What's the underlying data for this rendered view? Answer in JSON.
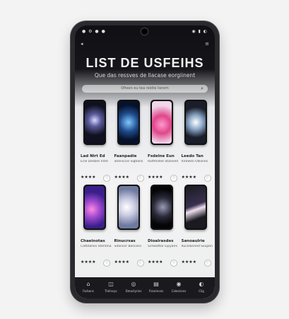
{
  "status_bar": {
    "left": "● ⚙ ● ●",
    "right": "◉ ▮ ◐"
  },
  "top_bar": {
    "left_icon": "◂",
    "right_icon": "≡"
  },
  "page": {
    "title": "LIST DE USFEIHS",
    "subtitle": "Que das ressves de llacase eorgiinent"
  },
  "search": {
    "placeholder": "Ofieen eu tea reidte lierem"
  },
  "products": [
    {
      "name": "Lad Nirt Ed",
      "desc": "Ecle Desbes Intel",
      "rating": "★★★★",
      "screen": "radial-gradient(circle at 50% 45%, #d9d9ff 0%, #5a5a9a 25%, #101020 60%)"
    },
    {
      "name": "Faanpadie",
      "desc": "Sheniccie Sigtions",
      "rating": "★★★★",
      "screen": "radial-gradient(circle at 50% 50%, #7fc8ff 0%, #1e4a8a 40%, #06112a 75%)"
    },
    {
      "name": "Fsdelne Eun",
      "desc": "Ruthhidee Stanned",
      "rating": "★★★★",
      "screen": "radial-gradient(circle at 50% 55%, #ff9ad0 0%, #e0468a 35%, #f0d6ea 75%)"
    },
    {
      "name": "Leedo Tan",
      "desc": "Rirewen Olliones",
      "rating": "★★★★",
      "screen": "radial-gradient(circle at 50% 50%, #ffffff 0%, #8ca8c8 30%, #1a1e2a 65%)"
    },
    {
      "name": "Chaeinotas",
      "desc": "Cattitanes Stentina",
      "rating": "★★★★",
      "screen": "radial-gradient(circle at 35% 55%, #ff8ae0 0%, #a04ad0 30%, #3a1f8a 65%)"
    },
    {
      "name": "Rinucrsas",
      "desc": "Sdancer Bancess",
      "rating": "★★★★",
      "screen": "radial-gradient(circle at 40% 50%, #ffffff 0%, #c9c9e0 35%, #6f7aa0 75%)"
    },
    {
      "name": "Dioalrasdes",
      "desc": "Schwattar Eipyalrs",
      "rating": "★★★★",
      "screen": "radial-gradient(circle at 55% 50%, #9a9ab5 0%, #2a2a3a 40%, #050507 75%)"
    },
    {
      "name": "Sanoaulrie",
      "desc": "Rucolanned Ssupen",
      "rating": "★★★★",
      "screen": "linear-gradient(160deg, #1a1a20 0%, #3a3050 45%, #f0e0f0 55%, #1a1a20 75%)"
    }
  ],
  "bottom_nav": [
    {
      "icon": "⌂",
      "label": "Farbons"
    },
    {
      "icon": "◫",
      "label": "Trelinsys"
    },
    {
      "icon": "◎",
      "label": "Dmactyries"
    },
    {
      "icon": "▤",
      "label": "Frzarmces"
    },
    {
      "icon": "◉",
      "label": "Calesrions"
    },
    {
      "icon": "◐",
      "label": "Cilg"
    }
  ]
}
